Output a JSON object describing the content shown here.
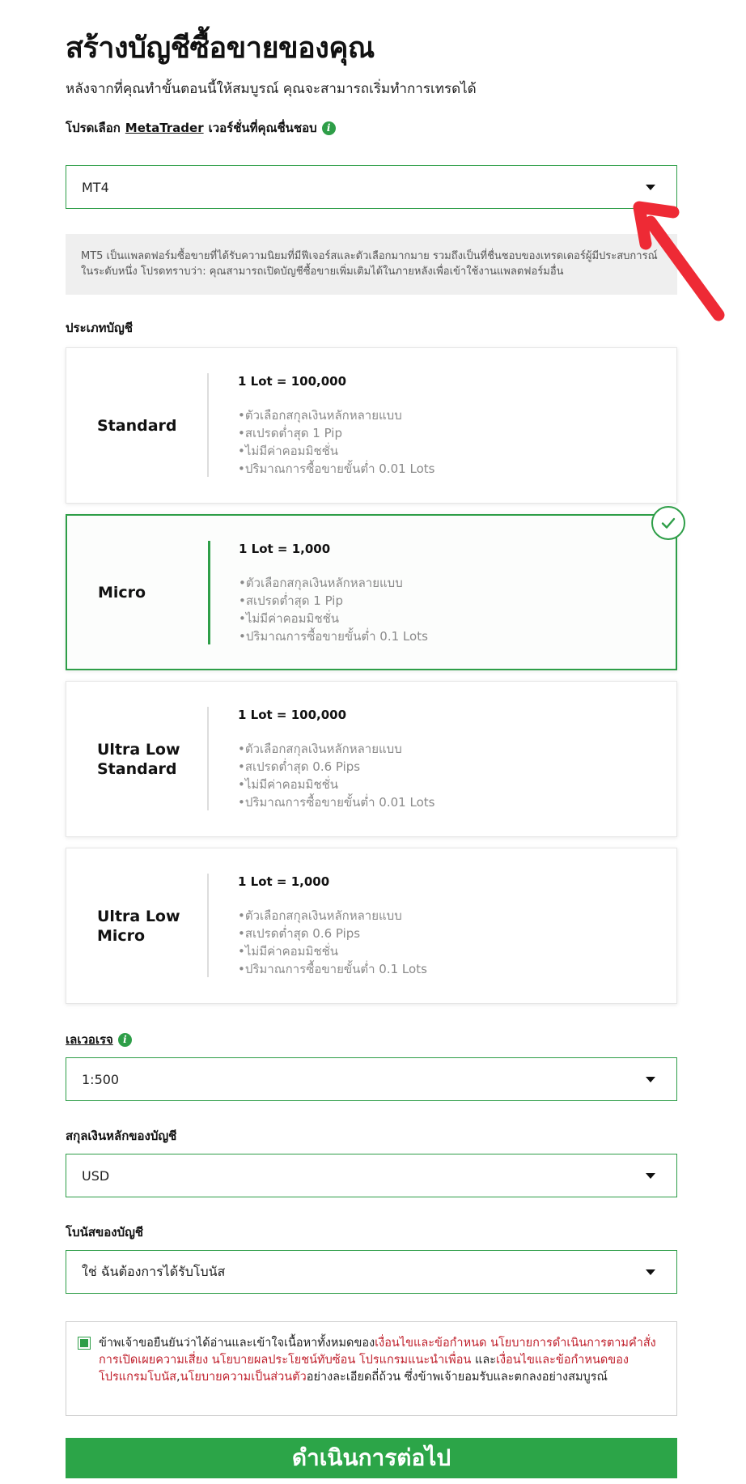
{
  "header": {
    "title": "สร้างบัญชีซื้อขายของคุณ",
    "subtitle": "หลังจากที่คุณทำขั้นตอนนี้ให้สมบูรณ์ คุณจะสามารถเริ่มทำการเทรดได้"
  },
  "platform": {
    "label_prefix": "โปรดเลือก",
    "label_link": "MetaTrader",
    "label_suffix": "เวอร์ชั่นที่คุณชื่นชอบ",
    "selected": "MT4",
    "note": "MT5 เป็นแพลตฟอร์มซื้อขายที่ได้รับความนิยมที่มีฟีเจอร์สและตัวเลือกมากมาย รวมถึงเป็นที่ชื่นชอบของเทรดเดอร์ผู้มีประสบการณ์ในระดับหนึ่ง โปรดทราบว่า: คุณสามารถเปิดบัญชีซื้อขายเพิ่มเติมได้ในภายหลังเพื่อเข้าใช้งานแพลตฟอร์มอื่น"
  },
  "account_type": {
    "label": "ประเภทบัญชี",
    "selected": "Micro",
    "cards": [
      {
        "name": "Standard",
        "lot": "1 Lot = 100,000",
        "features": [
          "•ตัวเลือกสกุลเงินหลักหลายแบบ",
          "•สเปรดต่ำสุด 1 Pip",
          "•ไม่มีค่าคอมมิชชั่น",
          "•ปริมาณการซื้อขายขั้นต่ำ 0.01 Lots"
        ]
      },
      {
        "name": "Micro",
        "lot": "1 Lot = 1,000",
        "features": [
          "•ตัวเลือกสกุลเงินหลักหลายแบบ",
          "•สเปรดต่ำสุด 1 Pip",
          "•ไม่มีค่าคอมมิชชั่น",
          "•ปริมาณการซื้อขายขั้นต่ำ 0.1 Lots"
        ]
      },
      {
        "name": "Ultra Low Standard",
        "lot": "1 Lot = 100,000",
        "features": [
          "•ตัวเลือกสกุลเงินหลักหลายแบบ",
          "•สเปรดต่ำสุด 0.6 Pips",
          "•ไม่มีค่าคอมมิชชั่น",
          "•ปริมาณการซื้อขายขั้นต่ำ 0.01 Lots"
        ]
      },
      {
        "name": "Ultra Low Micro",
        "lot": "1 Lot = 1,000",
        "features": [
          "•ตัวเลือกสกุลเงินหลักหลายแบบ",
          "•สเปรดต่ำสุด 0.6 Pips",
          "•ไม่มีค่าคอมมิชชั่น",
          "•ปริมาณการซื้อขายขั้นต่ำ 0.1 Lots"
        ]
      }
    ]
  },
  "leverage": {
    "label": "เลเวอเรจ",
    "selected": "1:500"
  },
  "currency": {
    "label": "สกุลเงินหลักของบัญชี",
    "selected": "USD"
  },
  "bonus": {
    "label": "โบนัสของบัญชี",
    "selected": "ใช่ ฉันต้องการได้รับโบนัส"
  },
  "terms": {
    "checked": true,
    "intro": "ข้าพเจ้าขอยืนยันว่าได้อ่านและเข้าใจเนื้อหาทั้งหมดของ",
    "link_terms": "เงื่อนไขและข้อกำหนด",
    "link_execution": "นโยบายการดำเนินการตามคำสั่ง",
    "link_risk": "การเปิดเผยความเสี่ยง",
    "link_conflict": "นโยบายผลประโยชน์ทับซ้อน",
    "link_referral": "โปรแกรมแนะนำเพื่อน",
    "and": "และ",
    "link_bonus_terms": "เงื่อนไขและข้อกำหนดของโปรแกรมโบนัส",
    "comma": ",",
    "link_privacy": "นโยบายความเป็นส่วนตัว",
    "outro": "อย่างละเอียดถี่ถ้วน ซึ่งข้าพเจ้ายอมรับและตกลงอย่างสมบูรณ์"
  },
  "submit": {
    "label": "ดำเนินการต่อไป"
  },
  "colors": {
    "accent": "#2e9e48",
    "link": "#c0202c",
    "annotation_arrow": "#ee2a35"
  }
}
